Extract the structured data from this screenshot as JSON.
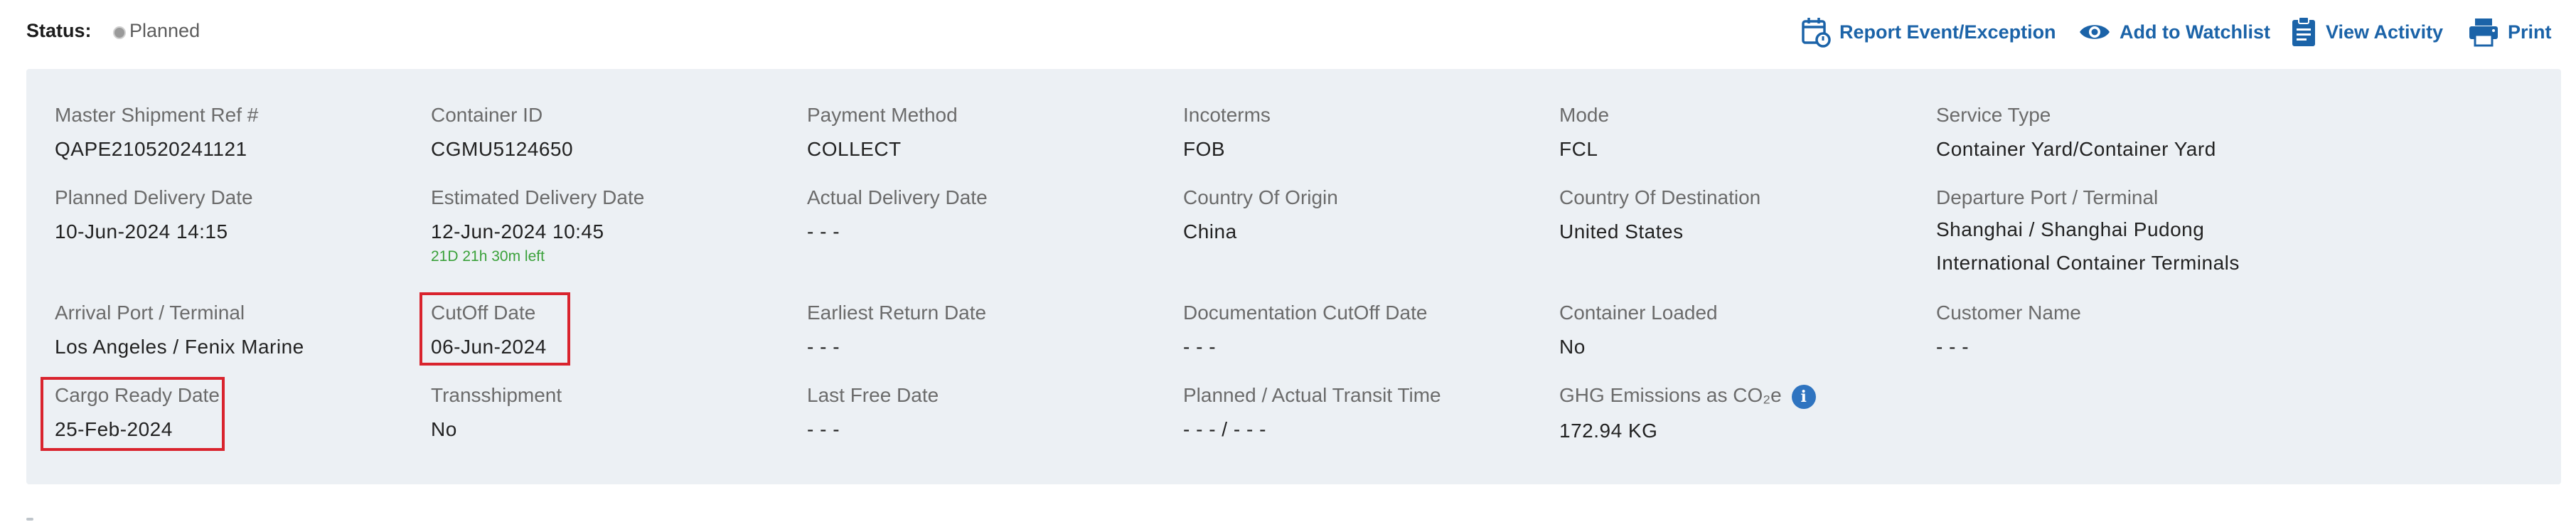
{
  "status": {
    "label": "Status:",
    "value": "Planned"
  },
  "actions": {
    "report": {
      "label": "Report Event/Exception",
      "icon": "calendar-alert-icon"
    },
    "watchlist": {
      "label": "Add to Watchlist",
      "icon": "eye-icon"
    },
    "activity": {
      "label": "View Activity",
      "icon": "clipboard-icon"
    },
    "print": {
      "label": "Print",
      "icon": "printer-icon"
    }
  },
  "colors": {
    "accent": "#1b63a8",
    "panel_bg": "#ecf0f4",
    "highlight": "#d9232d",
    "time_left": "#3aa13a"
  },
  "fields": {
    "master_ref": {
      "label": "Master Shipment Ref #",
      "value": "QAPE210520241121"
    },
    "container_id": {
      "label": "Container ID",
      "value": "CGMU5124650"
    },
    "payment_method": {
      "label": "Payment Method",
      "value": "COLLECT"
    },
    "incoterms": {
      "label": "Incoterms",
      "value": "FOB"
    },
    "mode": {
      "label": "Mode",
      "value": "FCL"
    },
    "service_type": {
      "label": "Service Type",
      "value": "Container Yard/Container Yard"
    },
    "planned_delivery": {
      "label": "Planned Delivery Date",
      "value": "10-Jun-2024 14:15"
    },
    "estimated_delivery": {
      "label": "Estimated Delivery Date",
      "value": "12-Jun-2024 10:45",
      "sub": "21D 21h 30m left"
    },
    "actual_delivery": {
      "label": "Actual Delivery Date",
      "value": "- - -"
    },
    "country_origin": {
      "label": "Country Of Origin",
      "value": "China"
    },
    "country_destination": {
      "label": "Country Of Destination",
      "value": "United States"
    },
    "departure_port": {
      "label": "Departure Port / Terminal",
      "value": "Shanghai / Shanghai Pudong International Container Terminals"
    },
    "arrival_port": {
      "label": "Arrival Port / Terminal",
      "value": "Los Angeles / Fenix Marine"
    },
    "cutoff_date": {
      "label": "CutOff Date",
      "value": "06-Jun-2024"
    },
    "earliest_return": {
      "label": "Earliest Return Date",
      "value": "- - -"
    },
    "doc_cutoff": {
      "label": "Documentation CutOff Date",
      "value": "- - -"
    },
    "container_loaded": {
      "label": "Container Loaded",
      "value": "No"
    },
    "customer_name": {
      "label": "Customer Name",
      "value": "- - -"
    },
    "cargo_ready": {
      "label": "Cargo Ready Date",
      "value": "25-Feb-2024"
    },
    "transshipment": {
      "label": "Transshipment",
      "value": "No"
    },
    "last_free_date": {
      "label": "Last Free Date",
      "value": "- - -"
    },
    "transit_time": {
      "label": "Planned / Actual Transit Time",
      "value": "- - - / - - -"
    },
    "ghg": {
      "label": "GHG Emissions as CO₂e",
      "value": "172.94 KG",
      "info_icon": "info-icon"
    }
  }
}
